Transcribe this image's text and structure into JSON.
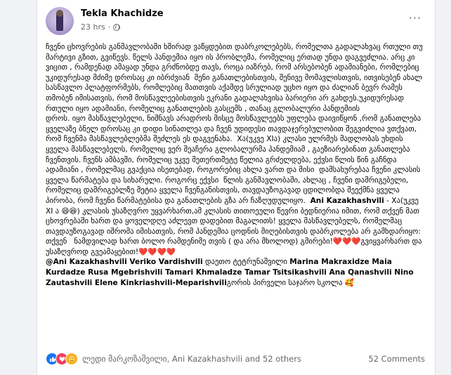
{
  "post": {
    "author": "Tekla Khachidze",
    "time": "23 hrs",
    "separator": "·",
    "more_label": "···",
    "paragraphs": [
      "ჩვენი ცხოვრების განმავლობაში ხშირად ვაწყდებით დაბრკოლებებს, რომელთა გადალახვაც რთული თუ მარტივი გზით, გვიწევს. წელს პანდემია იყო ის პრობლემა, რომელიც ერთად უნდა დაგვეძლია. არც კი ვიცით , რამდენად ამაყად უნდა გრძნობდე თავს, როცა იაზრებ, რომ არსებობენ ადამიანები, რომლებიც უკიდურესად მძიმე დროსაც კი იბრძვიან  შენი განათლებისთვის, შენივე მომავლისთვის, ითვისებენ ახალ სასწავლო პლატფორმებს, რომლებიც მათთვის აქამდე სრულიად უცხო იყო და ძალიან ბევრ რამეს თმობენ იმისათვის, რომ მოსწავლეებისთვის ეკრანი გადალახვისა ბარიერი არ გახდეს.უკიდურესად რთული იყო ადამიანი, რომელიც განათლების გასცემს , თანაც გლობალური პანდემიის",
      "დროს. იყო მასწავლებელი, ნიშნავს არადროს მისცე მოსწავლეებს უფლება დაივიწყონ ,რომ განათლება ყველაზე ბნელ დროსაც კი დიდი სინათლეა და ჩვენ უდიდესი თავდაჯერებულობით შეგვიძლია ვთქვათ, რომ ჩვენმა მასწავლებლებმა შეძლეს ეს დაგვენახა.  Xა(უკვე XIა) კლასი ულრმეს მადლობას უხდის ყველა მასწავლებელს, რომელიც ვერ შეაჩერა გლობალურმა პანდემიამ , გაეზიარებინათ განათლება ჩვენთვის. ჩვენს ამბავში, რომელიც უკვე მეთერთმეტე წელია გრძელდება, ექვსი წლის წინ გაჩნდა ადამიანი , რომელმაც გვაქცია ისეთებად, როგორებიც ახლა ვართ და მისი  დამსახურებაა ჩვენი კლასის ყველა წარმატება და სიხარული. როგორც ექვსი  წლის განმავლობაში, ახლაც , ჩვენი დამრიგებელი, რომელიც დამრიგებლზე მეტია ყველა ჩვენგანისთვის, თავდაუზოგავად ცდილობდა შეექმნა ყველა პირობა, რომ ჩვენი წარმატებისა და განათლების გზა არ ჩაზღუდულიყო.",
      "Xა(უკვე XI ა 😄😆) კლასის უსაზღვრო უყვარხართ,ამ კლასის თითოეული წევრი ბედნიერია იმით, რომ თქვენ მათ ცხოვრებაში ხართ და ყოველდღე აძლევთ დადებით მაგალითს! ყველა მასწავლებელს, რომელმაც თავდაუზოგავად იშრომა იმისათვის, რომ პანდემია ცოდნის მიღებისთვის დაბრკოლება არ გამხდარიყო: თქვენ   ნამდვილად ხართ ბოლო რამდენიმე თვის ( და არა მხოლოდ) გმირები!❤️❤️❤️გვიყვარხართ და უსაზღვროდ გვეამაყებით!❤️❤️❤️❤️"
    ],
    "mention_ani": "Ani Kazakhashvili",
    "tags_lead": "@Ani Kazakhashvili Veriko Vardishvili",
    "tags_mid": " დაეთო ტეტრუნაშვილი ",
    "tags_names": "Marina Makraxidze Maia Kurdadze Rusa Mgebrishvili Tamari Khmaladze Tamar Tsitsikashvili Ana Qanashvili Nino Zautashvili Elene Kinkriashvili-Meparishvili",
    "tags_tail": "გორის პირველი საჯარო სკოლა 🥰"
  },
  "footer": {
    "reactors": "ლედი მარკოზაშვილი, Ani Kazakhashvili and 52 others",
    "comments": "52 Comments",
    "reaction_icons": [
      "like-icon",
      "love-icon",
      "care-icon"
    ]
  },
  "colors": {
    "page_bg": "#f0f2f5",
    "card_bg": "#ffffff",
    "secondary_text": "#65676b",
    "like_blue": "#1877f2",
    "love_red": "#f33e58",
    "care_yellow": "#f7b125"
  }
}
